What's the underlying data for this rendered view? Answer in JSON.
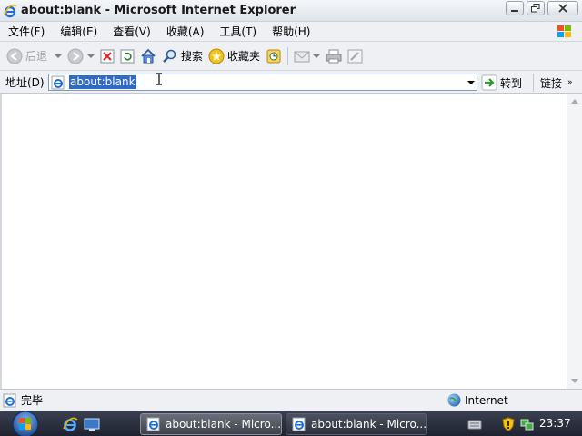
{
  "window": {
    "title": "about:blank - Microsoft Internet Explorer",
    "controls": {
      "minimize": "minimize",
      "restore": "restore",
      "close": "close"
    }
  },
  "menu": [
    {
      "label": "文件(F)"
    },
    {
      "label": "编辑(E)"
    },
    {
      "label": "查看(V)"
    },
    {
      "label": "收藏(A)"
    },
    {
      "label": "工具(T)"
    },
    {
      "label": "帮助(H)"
    }
  ],
  "toolbar": {
    "back_label": "后退",
    "search_label": "搜索",
    "favorites_label": "收藏夹"
  },
  "address": {
    "label": "地址(D)",
    "value": "about:blank",
    "go_label": "转到",
    "links_label": "链接",
    "links_chevron": "»"
  },
  "status": {
    "text": "完毕",
    "zone": "Internet"
  },
  "taskbar": {
    "tasks": [
      {
        "label": "about:blank - Micro..."
      },
      {
        "label": "about:blank - Micro..."
      }
    ],
    "clock": "23:37"
  },
  "colors": {
    "selection": "#316ac5",
    "taskbar": "#2a2e3a",
    "ie_blue": "#1f6fd1"
  }
}
